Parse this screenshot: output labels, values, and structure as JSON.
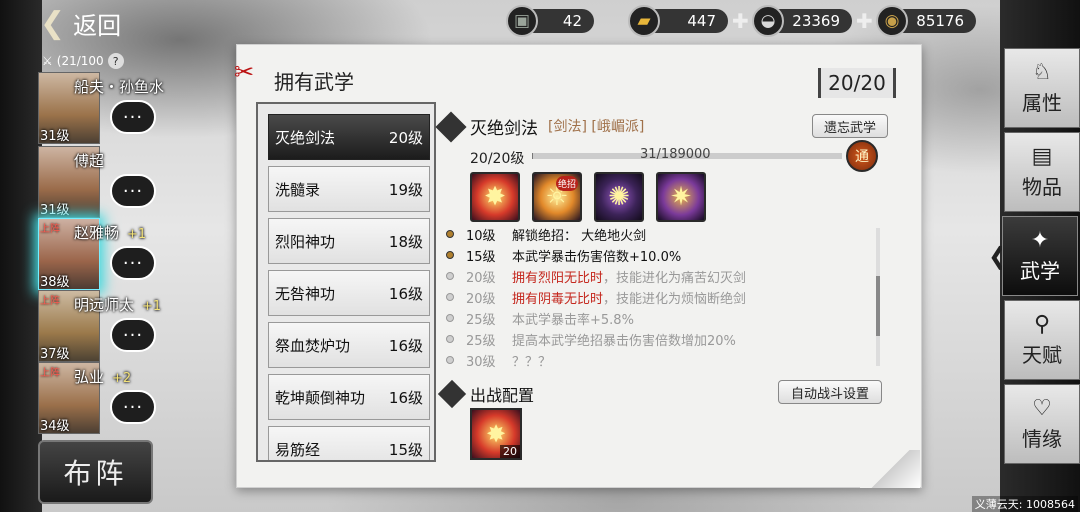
{
  "header": {
    "back_label": "返回"
  },
  "resources": [
    {
      "icon": "silver-chest-icon",
      "glyph": "▣",
      "value": "42",
      "has_plus": false,
      "color": "#9aa49a"
    },
    {
      "icon": "gold-bar-icon",
      "glyph": "▰",
      "value": "447",
      "has_plus": true,
      "color": "#e8b63a"
    },
    {
      "icon": "silver-ingot-icon",
      "glyph": "◒",
      "value": "23369",
      "has_plus": true,
      "color": "#d8d8d8"
    },
    {
      "icon": "copper-coin-icon",
      "glyph": "◉",
      "value": "85176",
      "has_plus": false,
      "color": "#c7a04a"
    }
  ],
  "roster": {
    "count": "(21/100",
    "help": "?",
    "characters": [
      {
        "name": "船夫・孙鱼水",
        "level": "31级",
        "tag": "",
        "plus": ""
      },
      {
        "name": "傅超",
        "level": "31级",
        "tag": "",
        "plus": ""
      },
      {
        "name": "赵雅畅",
        "level": "38级",
        "tag": "上阵",
        "plus": "+1"
      },
      {
        "name": "明远师太",
        "level": "37级",
        "tag": "上阵",
        "plus": "+1"
      },
      {
        "name": "弘业",
        "level": "34级",
        "tag": "上阵",
        "plus": "+2"
      }
    ],
    "bubble": "···",
    "formation_label": "布阵"
  },
  "panel": {
    "title": "拥有武学",
    "count": "20/20"
  },
  "skills": [
    {
      "name": "灭绝剑法",
      "level": "20级"
    },
    {
      "name": "洗髓录",
      "level": "19级"
    },
    {
      "name": "烈阳神功",
      "level": "18级"
    },
    {
      "name": "无咎神功",
      "level": "16级"
    },
    {
      "name": "祭血焚炉功",
      "level": "16级"
    },
    {
      "name": "乾坤颠倒神功",
      "level": "16级"
    },
    {
      "name": "易筋经",
      "level": "15级"
    }
  ],
  "detail": {
    "name": "灭绝剑法",
    "tags": "[剑法] [峨嵋派]",
    "forget_label": "遗忘武学",
    "level_text": "20/20级",
    "exp_text": "31/189000",
    "exp_fraction": 0.0002,
    "badge": "通",
    "ultimate_tag": "绝招",
    "effects": [
      {
        "lv": "10级",
        "parts": [
          {
            "t": "解锁绝招：  大绝地火剑",
            "red": false
          }
        ],
        "unlocked": true
      },
      {
        "lv": "15级",
        "parts": [
          {
            "t": "本武学暴击伤害倍数+10.0%",
            "red": false
          }
        ],
        "unlocked": true
      },
      {
        "lv": "20级",
        "parts": [
          {
            "t": "拥有烈阳无比时",
            "red": true
          },
          {
            "t": "，技能进化为痛苦幻灭剑",
            "red": false
          }
        ],
        "unlocked": false
      },
      {
        "lv": "20级",
        "parts": [
          {
            "t": "拥有阴毒无比时",
            "red": true
          },
          {
            "t": "，技能进化为烦恼断绝剑",
            "red": false
          }
        ],
        "unlocked": false
      },
      {
        "lv": "25级",
        "parts": [
          {
            "t": "本武学暴击率+5.8%",
            "red": false
          }
        ],
        "unlocked": false
      },
      {
        "lv": "25级",
        "parts": [
          {
            "t": "提高本武学绝招暴击伤害倍数增加20%",
            "red": false
          }
        ],
        "unlocked": false
      },
      {
        "lv": "30级",
        "parts": [
          {
            "t": "？？？",
            "red": false
          }
        ],
        "unlocked": false
      }
    ]
  },
  "battle_config": {
    "title": "出战配置",
    "auto_label": "自动战斗设置",
    "slot_level": "20"
  },
  "right_nav": [
    {
      "label": "属性",
      "icon": "attributes-icon",
      "glyph": "♘",
      "active": false
    },
    {
      "label": "物品",
      "icon": "items-icon",
      "glyph": "▤",
      "active": false
    },
    {
      "label": "武学",
      "icon": "martial-arts-icon",
      "glyph": "✦",
      "active": true
    },
    {
      "label": "天赋",
      "icon": "talent-icon",
      "glyph": "⚲",
      "active": false
    },
    {
      "label": "情缘",
      "icon": "affinity-icon",
      "glyph": "♡",
      "active": false
    }
  ],
  "watermark": "义薄云天: 1008564"
}
